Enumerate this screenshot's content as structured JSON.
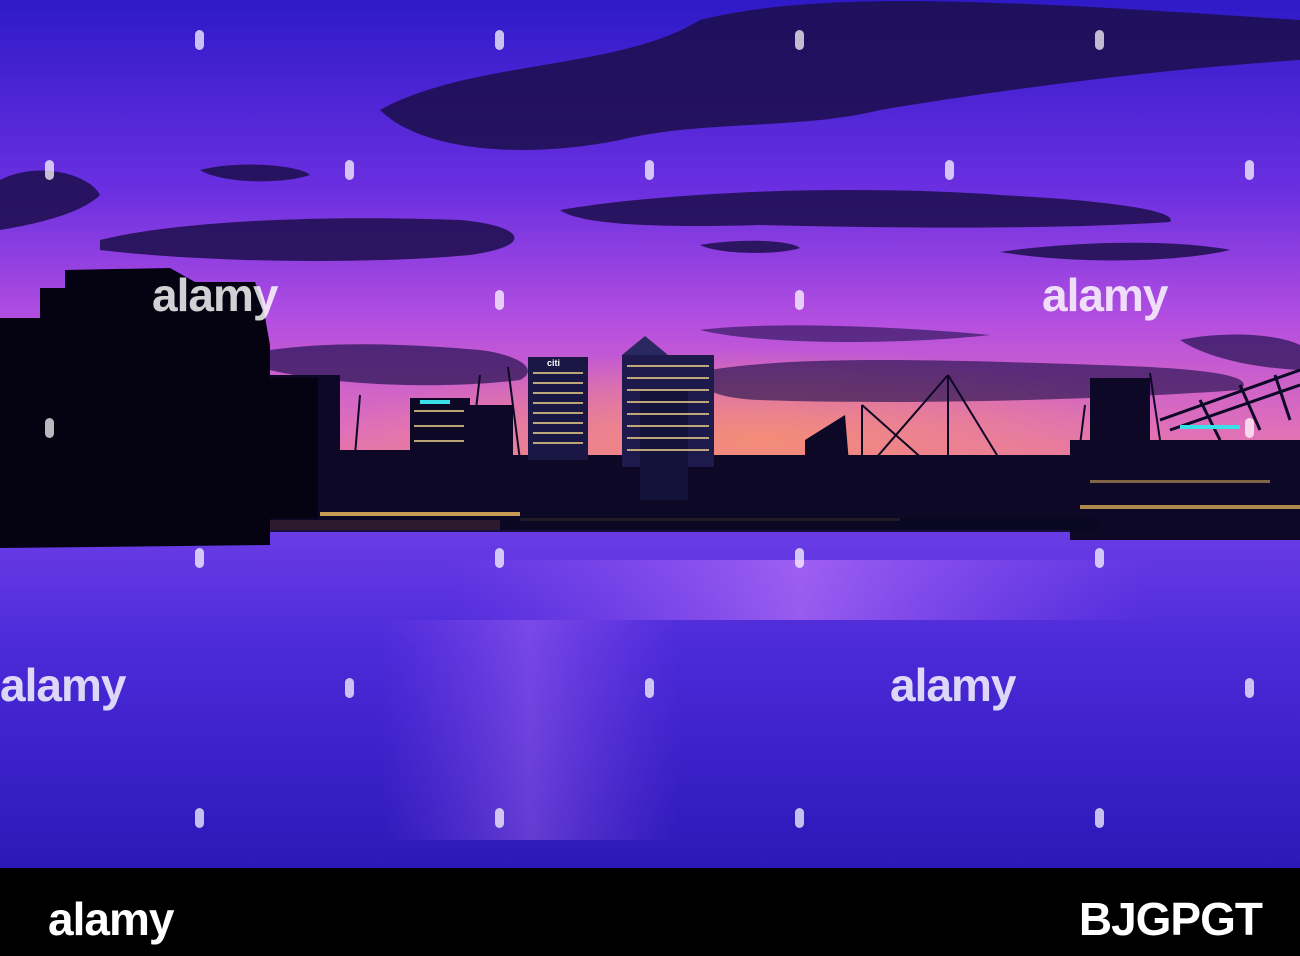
{
  "watermark": {
    "text": "alamy"
  },
  "footer": {
    "logo": "alamy",
    "image_id": "BJGPGT"
  },
  "building_signs": {
    "citi": "citi"
  },
  "colors": {
    "sky_top": "#3a1fd0",
    "sky_mid": "#9b3fe0",
    "horizon": "#f07a6a",
    "water": "#3a22c8",
    "silhouette": "#07051a"
  }
}
